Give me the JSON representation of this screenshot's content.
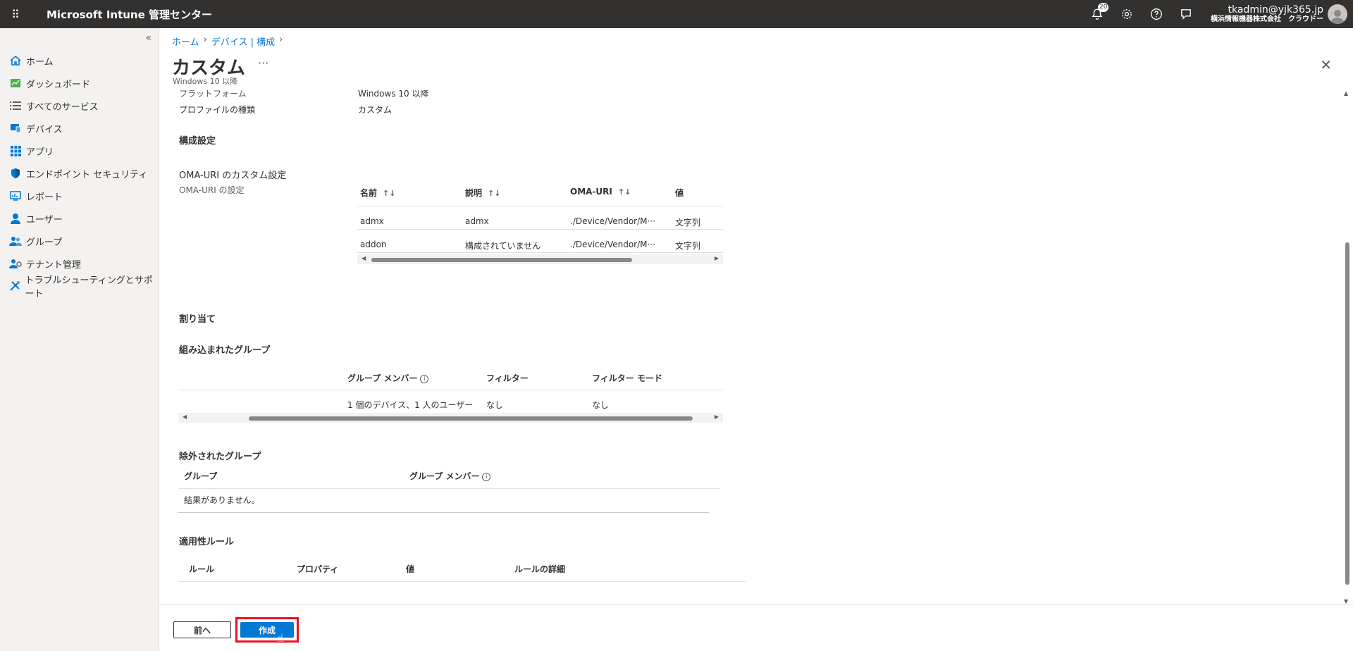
{
  "topbar": {
    "app_title": "Microsoft Intune 管理センター",
    "notif_count": "20",
    "account_name": "tkadmin@yjk365.jp",
    "account_org": "横浜情報機器株式会社　クラウドー"
  },
  "sidebar": {
    "collapse": "«",
    "items": [
      {
        "label": "ホーム",
        "icon": "home-icon"
      },
      {
        "label": "ダッシュボード",
        "icon": "dashboard-icon"
      },
      {
        "label": "すべてのサービス",
        "icon": "list-icon"
      },
      {
        "label": "デバイス",
        "icon": "device-icon"
      },
      {
        "label": "アプリ",
        "icon": "apps-icon"
      },
      {
        "label": "エンドポイント セキュリティ",
        "icon": "shield-icon"
      },
      {
        "label": "レポート",
        "icon": "report-icon"
      },
      {
        "label": "ユーザー",
        "icon": "user-icon"
      },
      {
        "label": "グループ",
        "icon": "group-icon"
      },
      {
        "label": "テナント管理",
        "icon": "tenant-icon"
      },
      {
        "label": "トラブルシューティングとサポート",
        "icon": "tools-icon"
      }
    ]
  },
  "breadcrumb": [
    "ホーム",
    "デバイス | 構成"
  ],
  "page": {
    "title": "カスタム",
    "more": "···",
    "subtitle": "Windows 10 以降",
    "close": "✕"
  },
  "summary": {
    "platform_label": "プラットフォーム",
    "platform_value": "Windows 10 以降",
    "profile_type_label": "プロファイルの種類",
    "profile_type_value": "カスタム"
  },
  "config": {
    "heading": "構成設定",
    "oma_heading": "OMA-URI のカスタム設定",
    "oma_label": "OMA-URI の設定",
    "columns": [
      "名前",
      "説明",
      "OMA-URI",
      "値"
    ],
    "sort_icon": "↑↓",
    "rows": [
      [
        "admx",
        "admx",
        "./Device/Vendor/M···",
        "文字列"
      ],
      [
        "addon",
        "構成されていません",
        "./Device/Vendor/M···",
        "文字列"
      ]
    ]
  },
  "assign": {
    "heading": "割り当て",
    "included_heading": "組み込まれたグループ",
    "included_columns": [
      "グループ メンバー",
      "フィルター",
      "フィルター モード"
    ],
    "included_row": [
      "1 個のデバイス、1 人のユーザー",
      "なし",
      "なし"
    ],
    "excluded_heading": "除外されたグループ",
    "excluded_columns": [
      "グループ",
      "グループ メンバー"
    ],
    "excluded_empty": "結果がありません。"
  },
  "applicability": {
    "heading": "適用性ルール",
    "columns": [
      "ルール",
      "プロパティ",
      "値",
      "ルールの詳細"
    ]
  },
  "footer": {
    "prev_label": "前へ",
    "create_label": "作成"
  }
}
